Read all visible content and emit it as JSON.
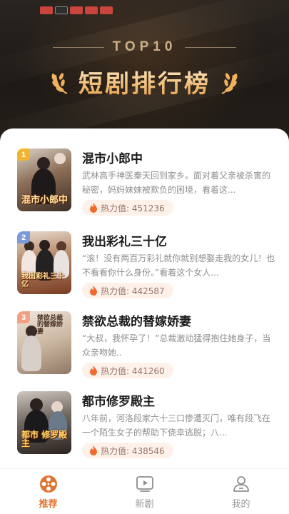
{
  "header": {
    "badge": "TOP10",
    "title": "短剧排行榜"
  },
  "colors": {
    "accent": "#e0732f",
    "rank1": "#f3b531",
    "rank2": "#7b9bd8",
    "rank3": "#f0a083"
  },
  "list": [
    {
      "rank": "1",
      "title": "混市小郎中",
      "desc": "武林高手神医秦天回到家乡。面对着父亲被杀害的秘密，妈妈妹妹被欺负的困境，看着这...",
      "heat": "热力值: 451236",
      "poster_text": "混市小郎中",
      "poster_icon": "poster-thumbnail"
    },
    {
      "rank": "2",
      "title": "我出彩礼三十亿",
      "desc": "“滚！没有两百万彩礼就你就别想娶走我的女儿！也不看看你什么身份。”看着这个女人...",
      "heat": "热力值: 442587",
      "poster_text": "我出彩礼三十亿",
      "poster_icon": "poster-thumbnail"
    },
    {
      "rank": "3",
      "title": "禁欲总裁的替嫁娇妻",
      "desc": "“大叔，我怀孕了！”总裁激动猛得抱住她身子，当众亲吻她..",
      "heat": "热力值: 441260",
      "poster_text": "禁欲总裁的替嫁娇妻",
      "poster_icon": "poster-thumbnail"
    },
    {
      "rank": "",
      "title": "都市修罗殿主",
      "desc": "八年前，河洛段家六十三口惨遭灭门，唯有段飞在一个陌生女子的帮助下侥幸逃脱；八...",
      "heat": "热力值: 438546",
      "poster_text": "都市 修罗殿主",
      "poster_icon": "poster-thumbnail"
    }
  ],
  "tabs": [
    {
      "label": "推荐",
      "icon": "film-reel-icon",
      "active": true
    },
    {
      "label": "新剧",
      "icon": "play-screen-icon",
      "active": false
    },
    {
      "label": "我的",
      "icon": "user-icon",
      "active": false
    }
  ]
}
